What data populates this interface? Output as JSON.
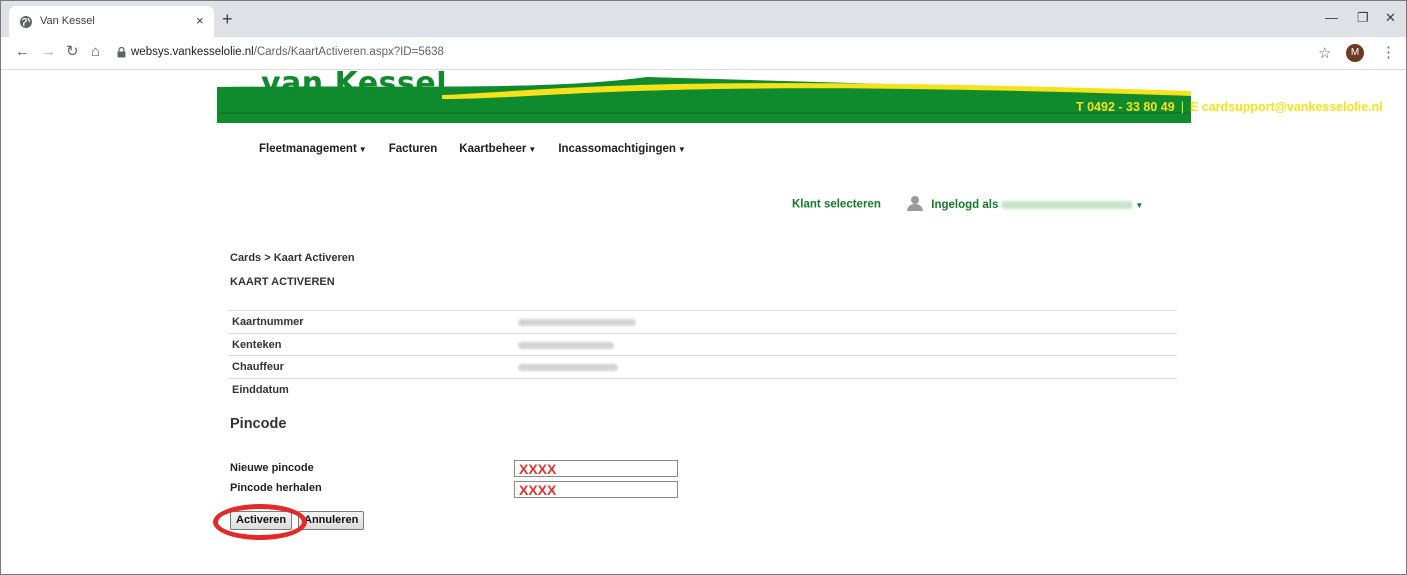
{
  "browser": {
    "tab_title": "Van Kessel",
    "tab_close": "×",
    "new_tab": "+",
    "url_host": "websys.vankesselolie.nl",
    "url_path": "/Cards/KaartActiveren.aspx?ID=5638",
    "profile_initial": "M",
    "icons": [
      "back-icon",
      "forward-icon",
      "reload-icon",
      "home-icon",
      "lock-icon",
      "star-icon",
      "kebab-menu-icon"
    ]
  },
  "banner": {
    "logo_text": "van Kessel",
    "phone": "T  0492 - 33 80 49",
    "separator": "|",
    "email": "E  cardsupport@vankesselolie.nl",
    "colors": {
      "green": "#0f8a2d",
      "yellow": "#f5e21a"
    }
  },
  "nav": {
    "items": [
      {
        "label": "Fleetmanagement",
        "dropdown": true
      },
      {
        "label": "Facturen",
        "dropdown": false
      },
      {
        "label": "Kaartbeheer",
        "dropdown": true
      },
      {
        "label": "Incassomachtigingen",
        "dropdown": true
      }
    ]
  },
  "userbar": {
    "select_client": "Klant selecteren",
    "logged_in_as": "Ingelogd als"
  },
  "breadcrumb": "Cards > Kaart Activeren",
  "page_title": "KAART ACTIVEREN",
  "details": [
    {
      "label": "Kaartnummer"
    },
    {
      "label": "Kenteken"
    },
    {
      "label": "Chauffeur"
    },
    {
      "label": "Einddatum"
    }
  ],
  "pincode": {
    "section_title": "Pincode",
    "new_label": "Nieuwe pincode",
    "new_value": "XXXX",
    "repeat_label": "Pincode herhalen",
    "repeat_value": "XXXX"
  },
  "buttons": {
    "activate": "Activeren",
    "cancel": "Annuleren"
  },
  "colors": {
    "link_green": "#137a2a",
    "highlight_red": "#e22a2a"
  }
}
